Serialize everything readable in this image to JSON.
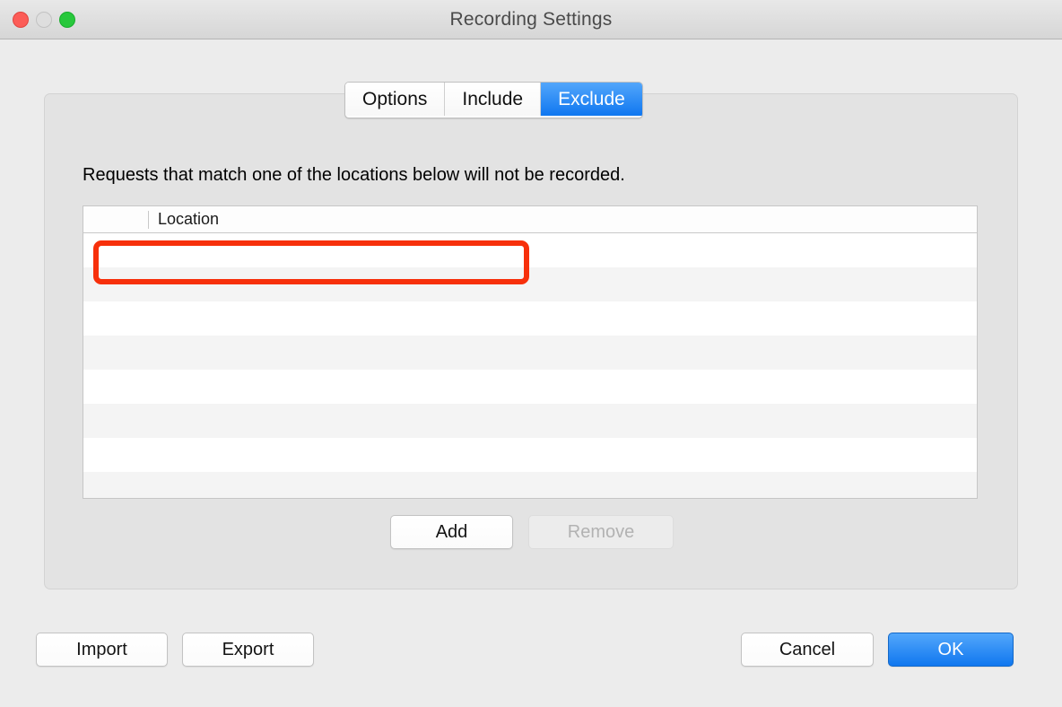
{
  "window": {
    "title": "Recording Settings",
    "traffic_lights": [
      {
        "name": "close",
        "color": "#fc5c57"
      },
      {
        "name": "minimize",
        "color": "#dedede"
      },
      {
        "name": "maximize",
        "color": "#28c83c"
      }
    ]
  },
  "tabs": [
    {
      "label": "Options",
      "selected": false
    },
    {
      "label": "Include",
      "selected": false
    },
    {
      "label": "Exclude",
      "selected": true
    }
  ],
  "panel": {
    "description": "Requests that match one of the locations below will not be recorded.",
    "table": {
      "columns": [
        "",
        "Location"
      ],
      "rows": [
        {
          "checked": false,
          "location": ""
        },
        {
          "checked": false,
          "location": ""
        },
        {
          "checked": false,
          "location": ""
        },
        {
          "checked": false,
          "location": ""
        },
        {
          "checked": false,
          "location": ""
        },
        {
          "checked": false,
          "location": ""
        },
        {
          "checked": false,
          "location": ""
        },
        {
          "checked": false,
          "location": ""
        }
      ]
    },
    "buttons": {
      "add": "Add",
      "remove": "Remove"
    }
  },
  "footer": {
    "import": "Import",
    "export": "Export",
    "cancel": "Cancel",
    "ok": "OK"
  },
  "annotation": {
    "color": "#f7300b",
    "shape": "rounded-rectangle-highlight"
  },
  "colors": {
    "accent": "#1077ef",
    "window_background": "#ececec",
    "group_background": "#e3e3e3",
    "row_stripe": "#f4f4f4"
  }
}
